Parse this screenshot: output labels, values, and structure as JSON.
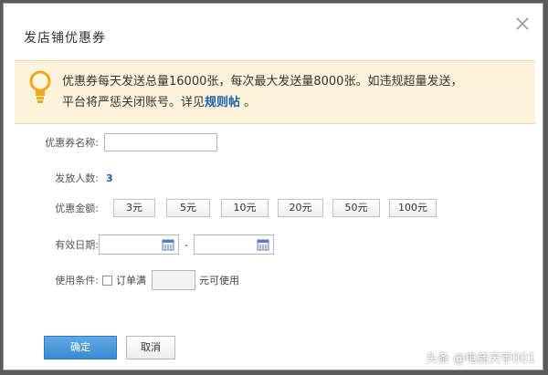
{
  "dialog": {
    "title": "发店铺优惠券",
    "close_icon": "close-icon"
  },
  "notice": {
    "icon": "lightbulb-icon",
    "line1": "优惠券每天发送总量16000张，每次最大发送量8000张。如违规超量发送，",
    "line2_prefix": "平台将严惩关闭账号。详见",
    "link": "规则帖",
    "line2_suffix": " 。"
  },
  "form": {
    "name_label": "优惠券名称:",
    "name_value": "",
    "recipients_label": "发放人数:",
    "recipients_value": "3",
    "amount_label": "优惠金额:",
    "amounts": [
      "3元",
      "5元",
      "10元",
      "20元",
      "50元",
      "100元"
    ],
    "date_label": "有效日期:",
    "date_start": "",
    "date_end": "",
    "date_separator": "-",
    "condition_label": "使用条件:",
    "condition_checkbox_label": "订单满",
    "condition_amount": "",
    "condition_suffix": "元可使用"
  },
  "buttons": {
    "confirm": "确定",
    "cancel": "取消"
  },
  "watermark": "头条 @电商天宇001",
  "colors": {
    "notice_bg": "#fdf3dc",
    "link": "#1b5fa8",
    "primary_button": "#3b8ad3"
  }
}
